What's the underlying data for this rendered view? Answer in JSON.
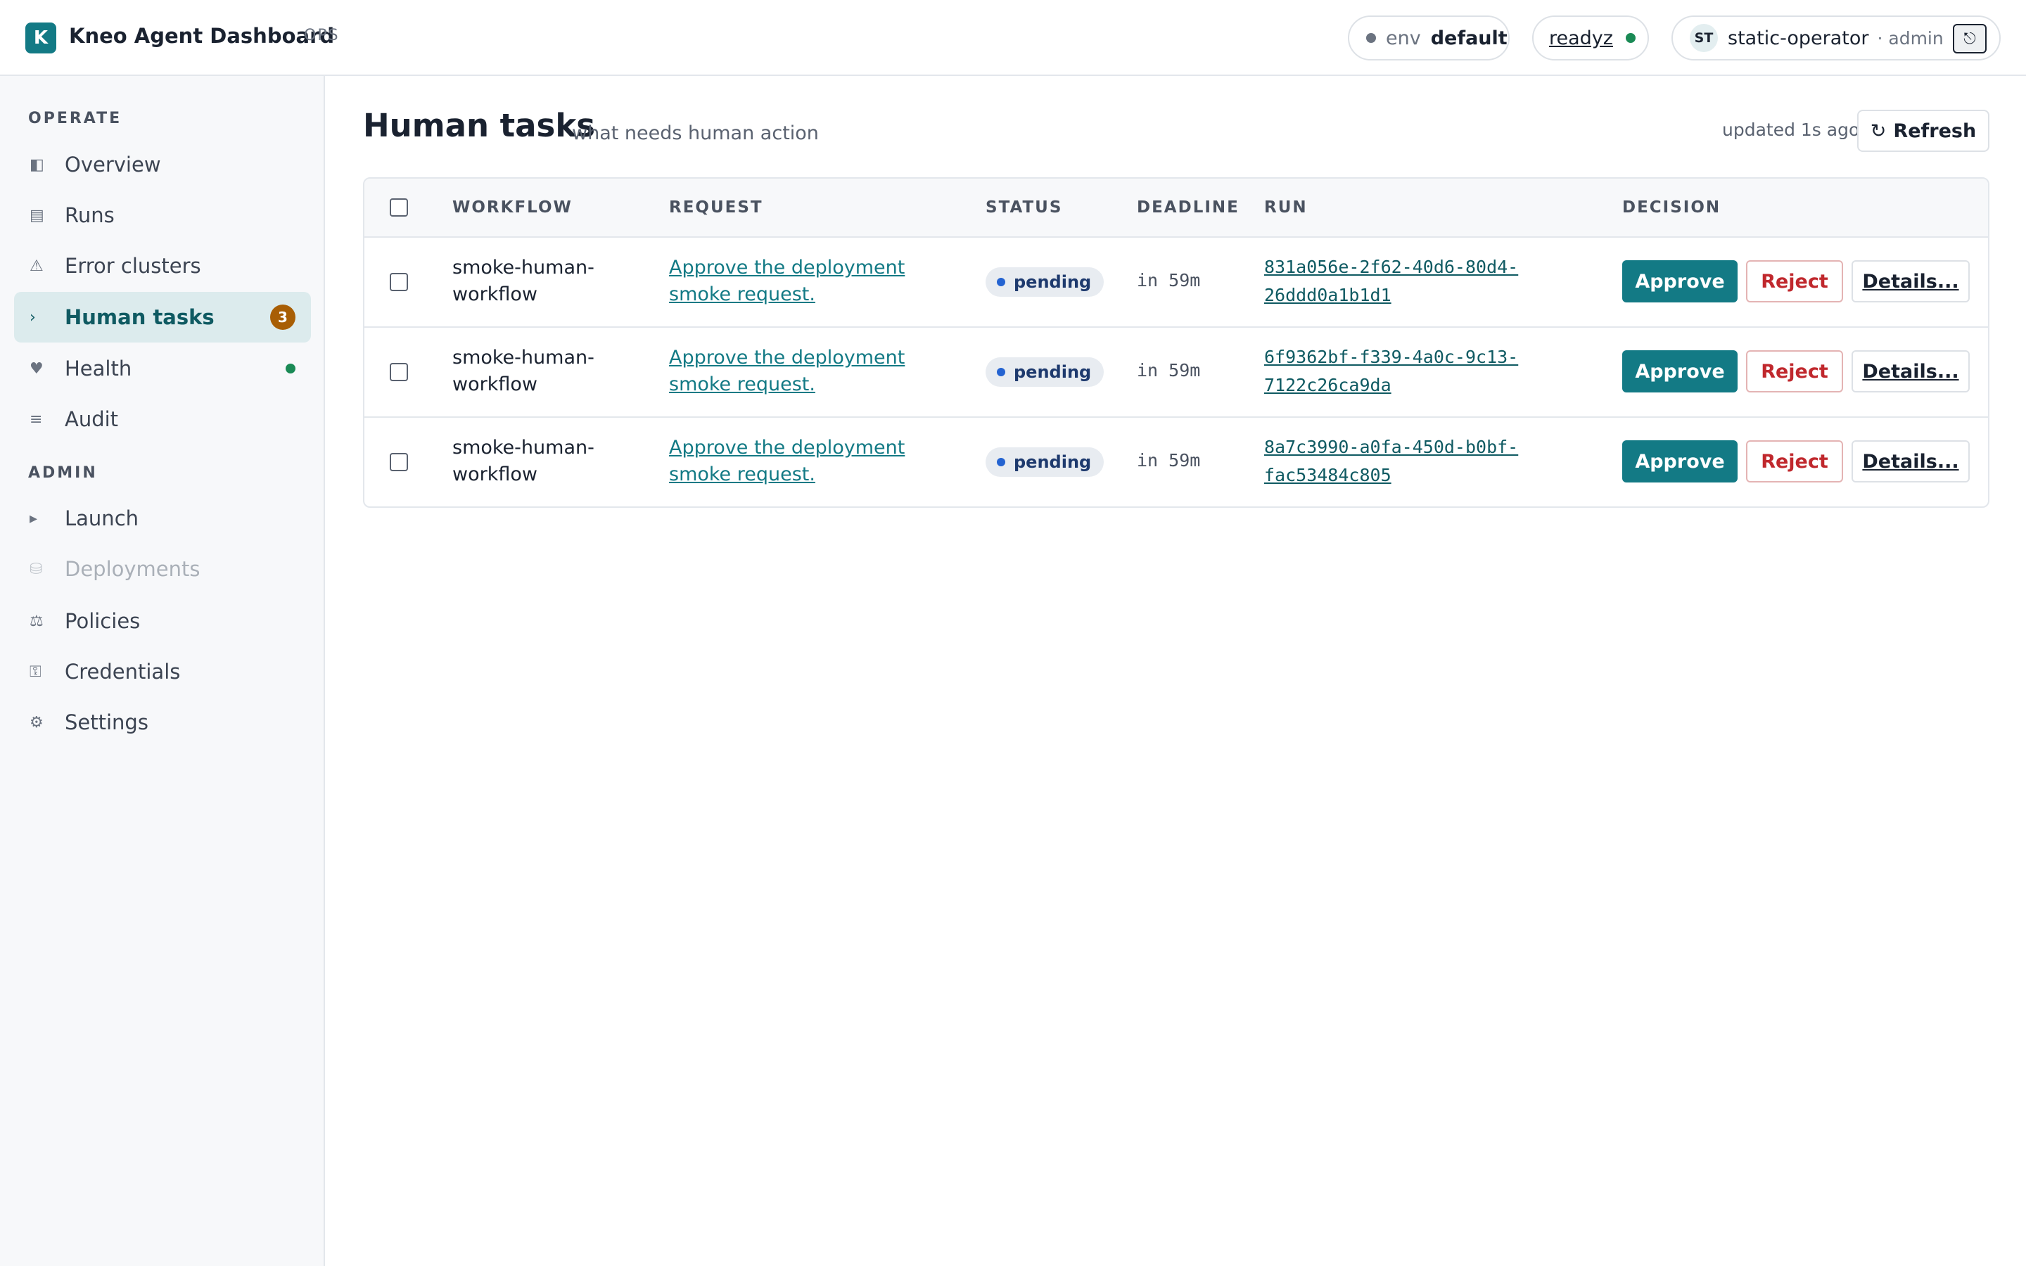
{
  "header": {
    "logo_letter": "K",
    "app_title": "Kneo Agent Dashboard",
    "app_tag": "OPS",
    "env_label": "env",
    "env_value": "default",
    "readiness_label": "readyz",
    "user_initials": "ST",
    "user_name": "static-operator",
    "user_role": "· admin",
    "logout_icon": "logout-icon"
  },
  "sidebar": {
    "operate_label": "OPERATE",
    "admin_label": "ADMIN",
    "operate_items": [
      {
        "label": "Overview",
        "icon": "overview-icon",
        "glyph": "◧"
      },
      {
        "label": "Runs",
        "icon": "runs-icon",
        "glyph": "▤"
      },
      {
        "label": "Error clusters",
        "icon": "warning-icon",
        "glyph": "⚠"
      },
      {
        "label": "Human tasks",
        "icon": "chevron-right-icon",
        "glyph": "›",
        "badge": "3"
      },
      {
        "label": "Health",
        "icon": "heart-icon",
        "glyph": "♥"
      },
      {
        "label": "Audit",
        "icon": "audit-icon",
        "glyph": "≡"
      }
    ],
    "admin_items": [
      {
        "label": "Launch",
        "icon": "play-icon",
        "glyph": "▸"
      },
      {
        "label": "Deployments",
        "icon": "deployments-icon",
        "glyph": "⛁"
      },
      {
        "label": "Policies",
        "icon": "scale-icon",
        "glyph": "⚖"
      },
      {
        "label": "Credentials",
        "icon": "key-icon",
        "glyph": "⚿"
      },
      {
        "label": "Settings",
        "icon": "gear-icon",
        "glyph": "⚙"
      }
    ]
  },
  "main": {
    "title": "Human tasks",
    "subtitle": "what needs human action",
    "updated": "updated 1s ago",
    "refresh_icon": "↻",
    "refresh_label": "Refresh",
    "columns": [
      "WORKFLOW",
      "REQUEST",
      "STATUS",
      "DEADLINE",
      "RUN",
      "DECISION"
    ],
    "rows": [
      {
        "workflow": "smoke-human-workflow",
        "request": "Approve the deployment smoke request.",
        "status": "pending",
        "deadline": "in 59m",
        "run": "831a056e-2f62-40d6-80d4-26ddd0a1b1d1"
      },
      {
        "workflow": "smoke-human-workflow",
        "request": "Approve the deployment smoke request.",
        "status": "pending",
        "deadline": "in 59m",
        "run": "6f9362bf-f339-4a0c-9c13-7122c26ca9da"
      },
      {
        "workflow": "smoke-human-workflow",
        "request": "Approve the deployment smoke request.",
        "status": "pending",
        "deadline": "in 59m",
        "run": "8a7c3990-a0fa-450d-b0bf-fac53484c805"
      }
    ],
    "actions": {
      "approve": "Approve",
      "reject": "Reject",
      "details": "Details..."
    }
  },
  "colors": {
    "accent": "#137a85",
    "badge": "#a85e05",
    "health_ok": "#1a8a55",
    "reject": "#c0282d",
    "status_dot": "#2463d1"
  }
}
